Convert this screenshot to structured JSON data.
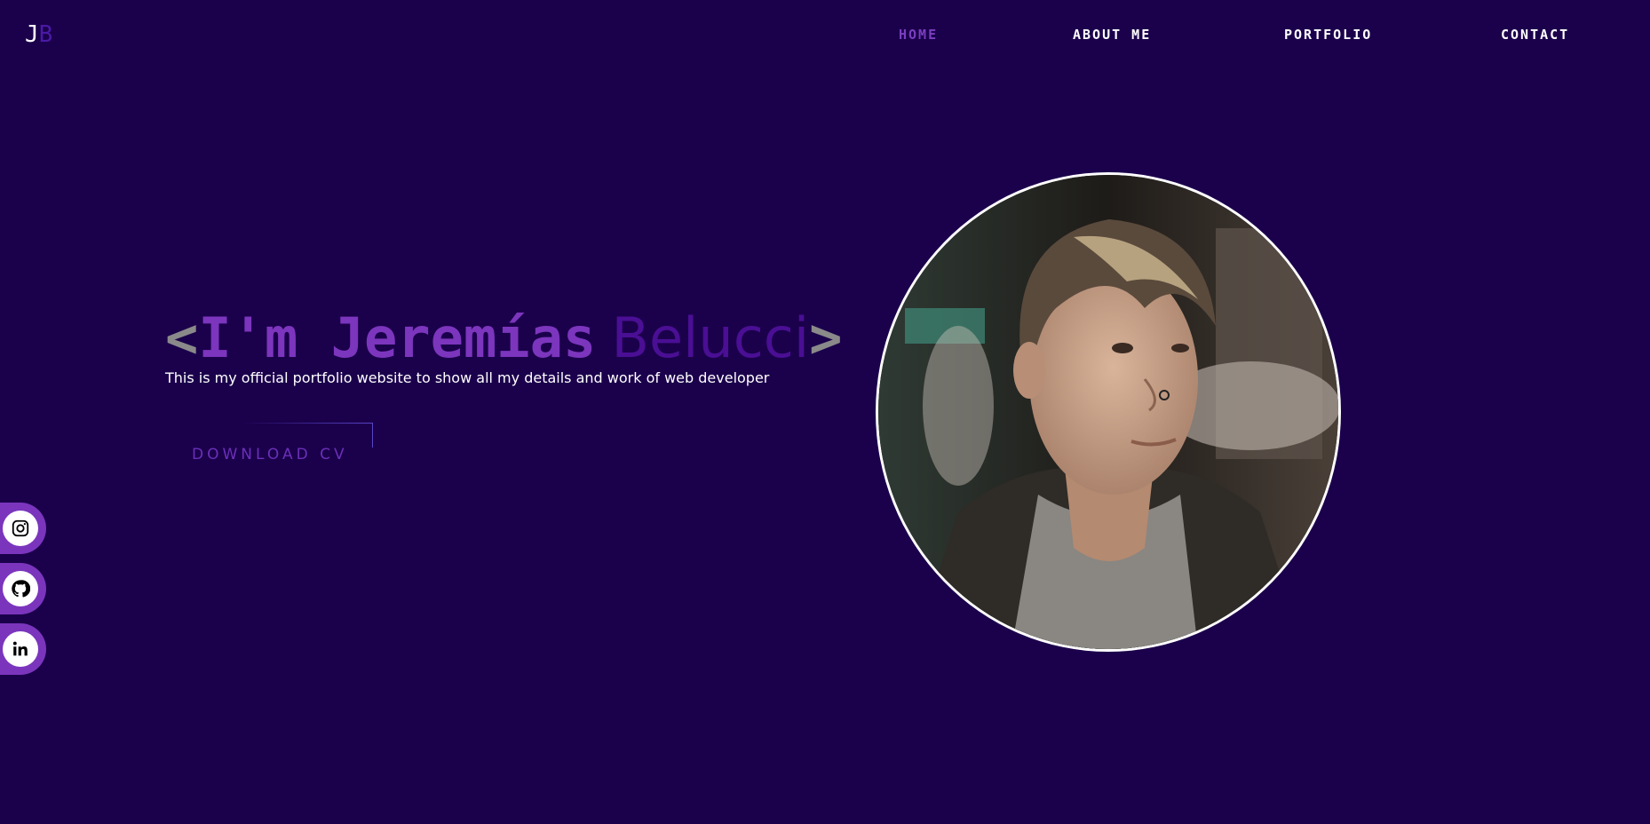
{
  "logo": {
    "j": "J",
    "b": "B"
  },
  "nav": [
    {
      "label": "HOME",
      "active": true
    },
    {
      "label": "ABOUT ME",
      "active": false
    },
    {
      "label": "PORTFOLIO",
      "active": false
    },
    {
      "label": "CONTACT",
      "active": false
    }
  ],
  "hero": {
    "open_bracket": "<",
    "first_part": "I'm Jeremías",
    "last_part": "Belucci",
    "close_bracket": ">",
    "subtitle": "This is my official portfolio website to show all my details and work of web developer",
    "cta_label": "DOWNLOAD CV"
  },
  "social": [
    {
      "icon": "instagram-icon"
    },
    {
      "icon": "github-icon"
    },
    {
      "icon": "linkedin-icon"
    }
  ],
  "colors": {
    "background": "#1b004c",
    "accent": "#7c35bd",
    "accent_dark": "#4a0f94",
    "white": "#ffffff"
  }
}
